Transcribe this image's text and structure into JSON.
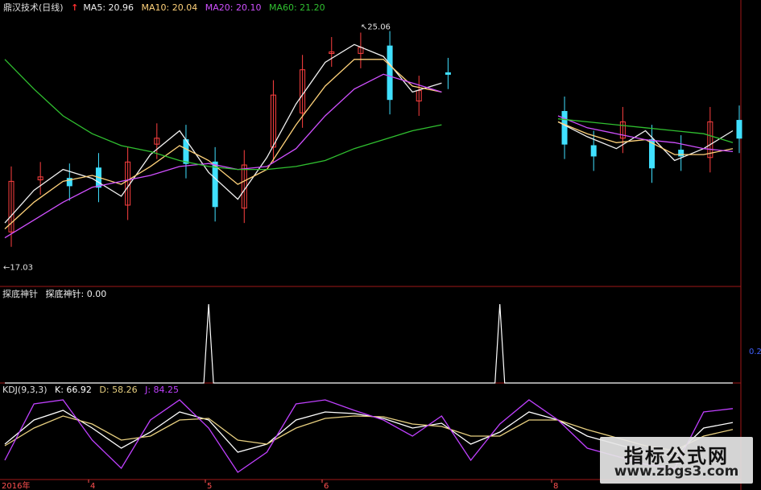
{
  "colors": {
    "bg": "#000000",
    "up": "#ff4040",
    "down": "#40e0ff",
    "ma5": "#f0f0f0",
    "ma10": "#ffd27a",
    "ma20": "#d050ff",
    "ma60": "#30c030",
    "divider": "#a01818",
    "kdj_k": "#ffffff",
    "kdj_d": "#e8d080",
    "kdj_j": "#c040ff"
  },
  "header": {
    "title": "鼎汉技术(日线)",
    "ma5": "MA5: 20.96",
    "ma10": "MA10: 20.04",
    "ma20": "MA20: 20.10",
    "ma60": "MA60: 21.20"
  },
  "annotations": {
    "high": "25.06",
    "low": "17.03"
  },
  "indicator": {
    "title": "探底神针",
    "value_label": "探底神针: 0.00",
    "side_tick": "0.2"
  },
  "kdj": {
    "title": "KDJ(9,3,3)",
    "k": "K: 66.92",
    "d": "D: 58.26",
    "j": "J: 84.25"
  },
  "xaxis": {
    "year": "2016年",
    "months": [
      "4",
      "5",
      "6",
      "8"
    ]
  },
  "watermark": {
    "line1": "指标公式网",
    "line2": "www.zbgs3.com"
  },
  "chart_data": [
    {
      "type": "line",
      "title": "鼎汉技术(日线)",
      "series": [
        {
          "name": "MA5",
          "values": [
            18.5,
            19.6,
            20.3,
            20.0,
            19.4,
            20.8,
            21.6,
            20.2,
            19.3,
            20.7,
            22.5,
            23.9,
            24.5,
            24.1,
            22.9,
            23.2,
            null,
            null,
            null,
            21.9,
            21.4,
            21.0,
            21.6,
            20.6,
            21.0,
            21.6
          ]
        },
        {
          "name": "MA10",
          "values": [
            18.3,
            19.2,
            19.9,
            20.1,
            19.8,
            20.4,
            21.1,
            20.6,
            19.8,
            20.3,
            21.8,
            23.1,
            24.0,
            24.0,
            23.1,
            22.9,
            null,
            null,
            null,
            21.9,
            21.5,
            21.2,
            21.3,
            20.8,
            20.8,
            21.0
          ]
        },
        {
          "name": "MA20",
          "values": [
            18.0,
            18.6,
            19.2,
            19.7,
            19.9,
            20.1,
            20.4,
            20.5,
            20.3,
            20.4,
            21.0,
            22.1,
            23.0,
            23.5,
            23.2,
            22.9,
            null,
            null,
            null,
            22.1,
            21.7,
            21.5,
            21.3,
            21.2,
            21.0,
            20.9
          ]
        },
        {
          "name": "MA60",
          "values": [
            24.0,
            23.0,
            22.1,
            21.5,
            21.1,
            20.9,
            20.6,
            20.4,
            20.3,
            20.3,
            20.4,
            20.6,
            21.0,
            21.3,
            21.6,
            21.8,
            null,
            null,
            null,
            22.0,
            21.9,
            21.8,
            21.7,
            21.6,
            21.5,
            21.2
          ]
        }
      ],
      "ylim": [
        16.8,
        25.4
      ],
      "high": 25.06,
      "low": 17.03
    },
    {
      "type": "line",
      "title": "探底神针",
      "series": [
        {
          "name": "探底神针",
          "values": [
            0,
            0,
            0,
            0,
            0,
            0,
            0,
            0.2,
            0,
            0,
            0,
            0,
            0,
            0,
            0,
            0,
            0,
            0.2,
            0,
            0,
            0,
            0,
            0,
            0,
            0,
            0
          ]
        }
      ]
    },
    {
      "type": "line",
      "title": "KDJ(9,3,3)",
      "series": [
        {
          "name": "K",
          "values": [
            40,
            70,
            82,
            60,
            35,
            55,
            80,
            70,
            30,
            40,
            70,
            80,
            78,
            72,
            60,
            66,
            40,
            55,
            80,
            70,
            50,
            40,
            30,
            25,
            60,
            66.92
          ]
        },
        {
          "name": "D",
          "values": [
            38,
            60,
            75,
            65,
            45,
            50,
            70,
            72,
            45,
            40,
            60,
            72,
            75,
            74,
            65,
            62,
            50,
            50,
            70,
            70,
            58,
            48,
            38,
            32,
            50,
            58.26
          ]
        },
        {
          "name": "J",
          "values": [
            20,
            90,
            95,
            45,
            10,
            70,
            95,
            60,
            5,
            30,
            90,
            95,
            82,
            70,
            50,
            75,
            20,
            65,
            95,
            70,
            35,
            25,
            15,
            10,
            80,
            84.25
          ]
        }
      ],
      "ylim": [
        0,
        100
      ]
    }
  ]
}
